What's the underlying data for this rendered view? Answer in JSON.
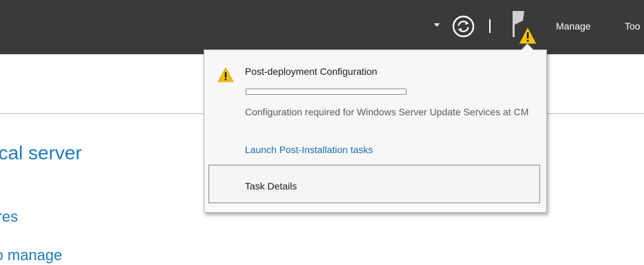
{
  "topbar": {
    "icons": {
      "dropdown": "chevron-down-icon",
      "refresh": "refresh-icon",
      "notifications": "flag-warning-icon"
    },
    "menu": {
      "manage": "Manage",
      "tools": "Too"
    }
  },
  "content": {
    "heading": "ocal server",
    "link_1": "atures",
    "link_2": "rs to manage"
  },
  "notification_popup": {
    "icon": "warning-icon",
    "title": "Post-deployment Configuration",
    "progress": 0.0,
    "message": "Configuration required for Windows Server Update Services at CM",
    "link": "Launch Post-Installation tasks",
    "button": "Task Details"
  },
  "colors": {
    "topbar_bg": "#3a3a3a",
    "warning": "#f5c000",
    "link": "#1a6fb0",
    "content_text": "#1e7bbf",
    "popup_bg": "#f7f7f7"
  }
}
